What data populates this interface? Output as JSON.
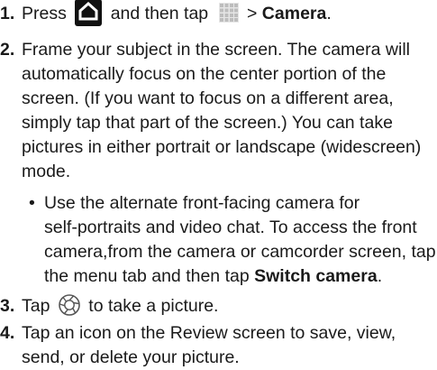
{
  "steps": [
    {
      "number": "1.",
      "pre_icon_home": "Press",
      "between_icons": "and then tap",
      "after_apps": "> ",
      "bold_camera": "Camera",
      "end": "."
    },
    {
      "number": "2.",
      "line1": "Frame your subject in the screen. The camera will",
      "line2": "automatically focus on the center portion of the",
      "line3": "screen. (If you want to focus on a different area,",
      "line4": "simply tap that part of the screen.) You can take",
      "line5": "pictures in either portrait or landscape (widescreen)",
      "line6": "mode."
    },
    {
      "number": "3.",
      "pre": "Tap",
      "post": "to take a picture."
    },
    {
      "number": "4.",
      "line1": "Tap an icon on the Review screen to save, view,",
      "line2": "send, or delete your picture."
    }
  ],
  "sub_bullet": {
    "bullet": "•",
    "line1": "Use the alternate front-facing camera for",
    "line2": "self-portraits and video chat. To access the front",
    "line3": "camera,from the camera or camcorder screen, tap",
    "line4_pre": "the menu tab and then tap ",
    "line4_bold": "Switch camera",
    "line4_post": "."
  },
  "icons": {
    "home": "home-icon",
    "apps": "apps-grid-icon",
    "shutter": "camera-shutter-icon"
  },
  "colors": {
    "text": "#1a1a1a",
    "home_icon_bg": "#111111",
    "apps_icon": "#bdbdbd",
    "shutter_icon": "#555555"
  }
}
